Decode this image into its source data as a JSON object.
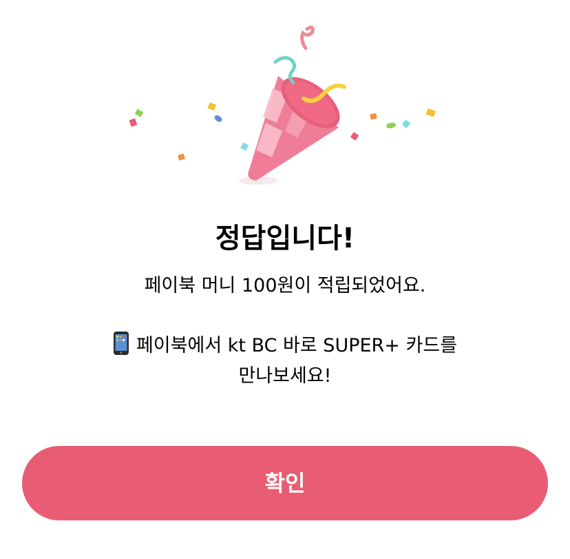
{
  "dialog": {
    "title": "정답입니다!",
    "subtitle": "페이북 머니 100원이 적립되었어요.",
    "promo_line1": "페이북에서 kt BC 바로 SUPER+ 카드를",
    "promo_line2": "만나보세요!",
    "promo_icon": "mobile-phone-icon",
    "illustration": "party-popper-icon",
    "confirm_label": "확인"
  },
  "colors": {
    "button": "#e85d73",
    "button_text": "#ffffff",
    "popper_pink": "#ef7d98",
    "popper_stripe": "#f9bfcc"
  }
}
